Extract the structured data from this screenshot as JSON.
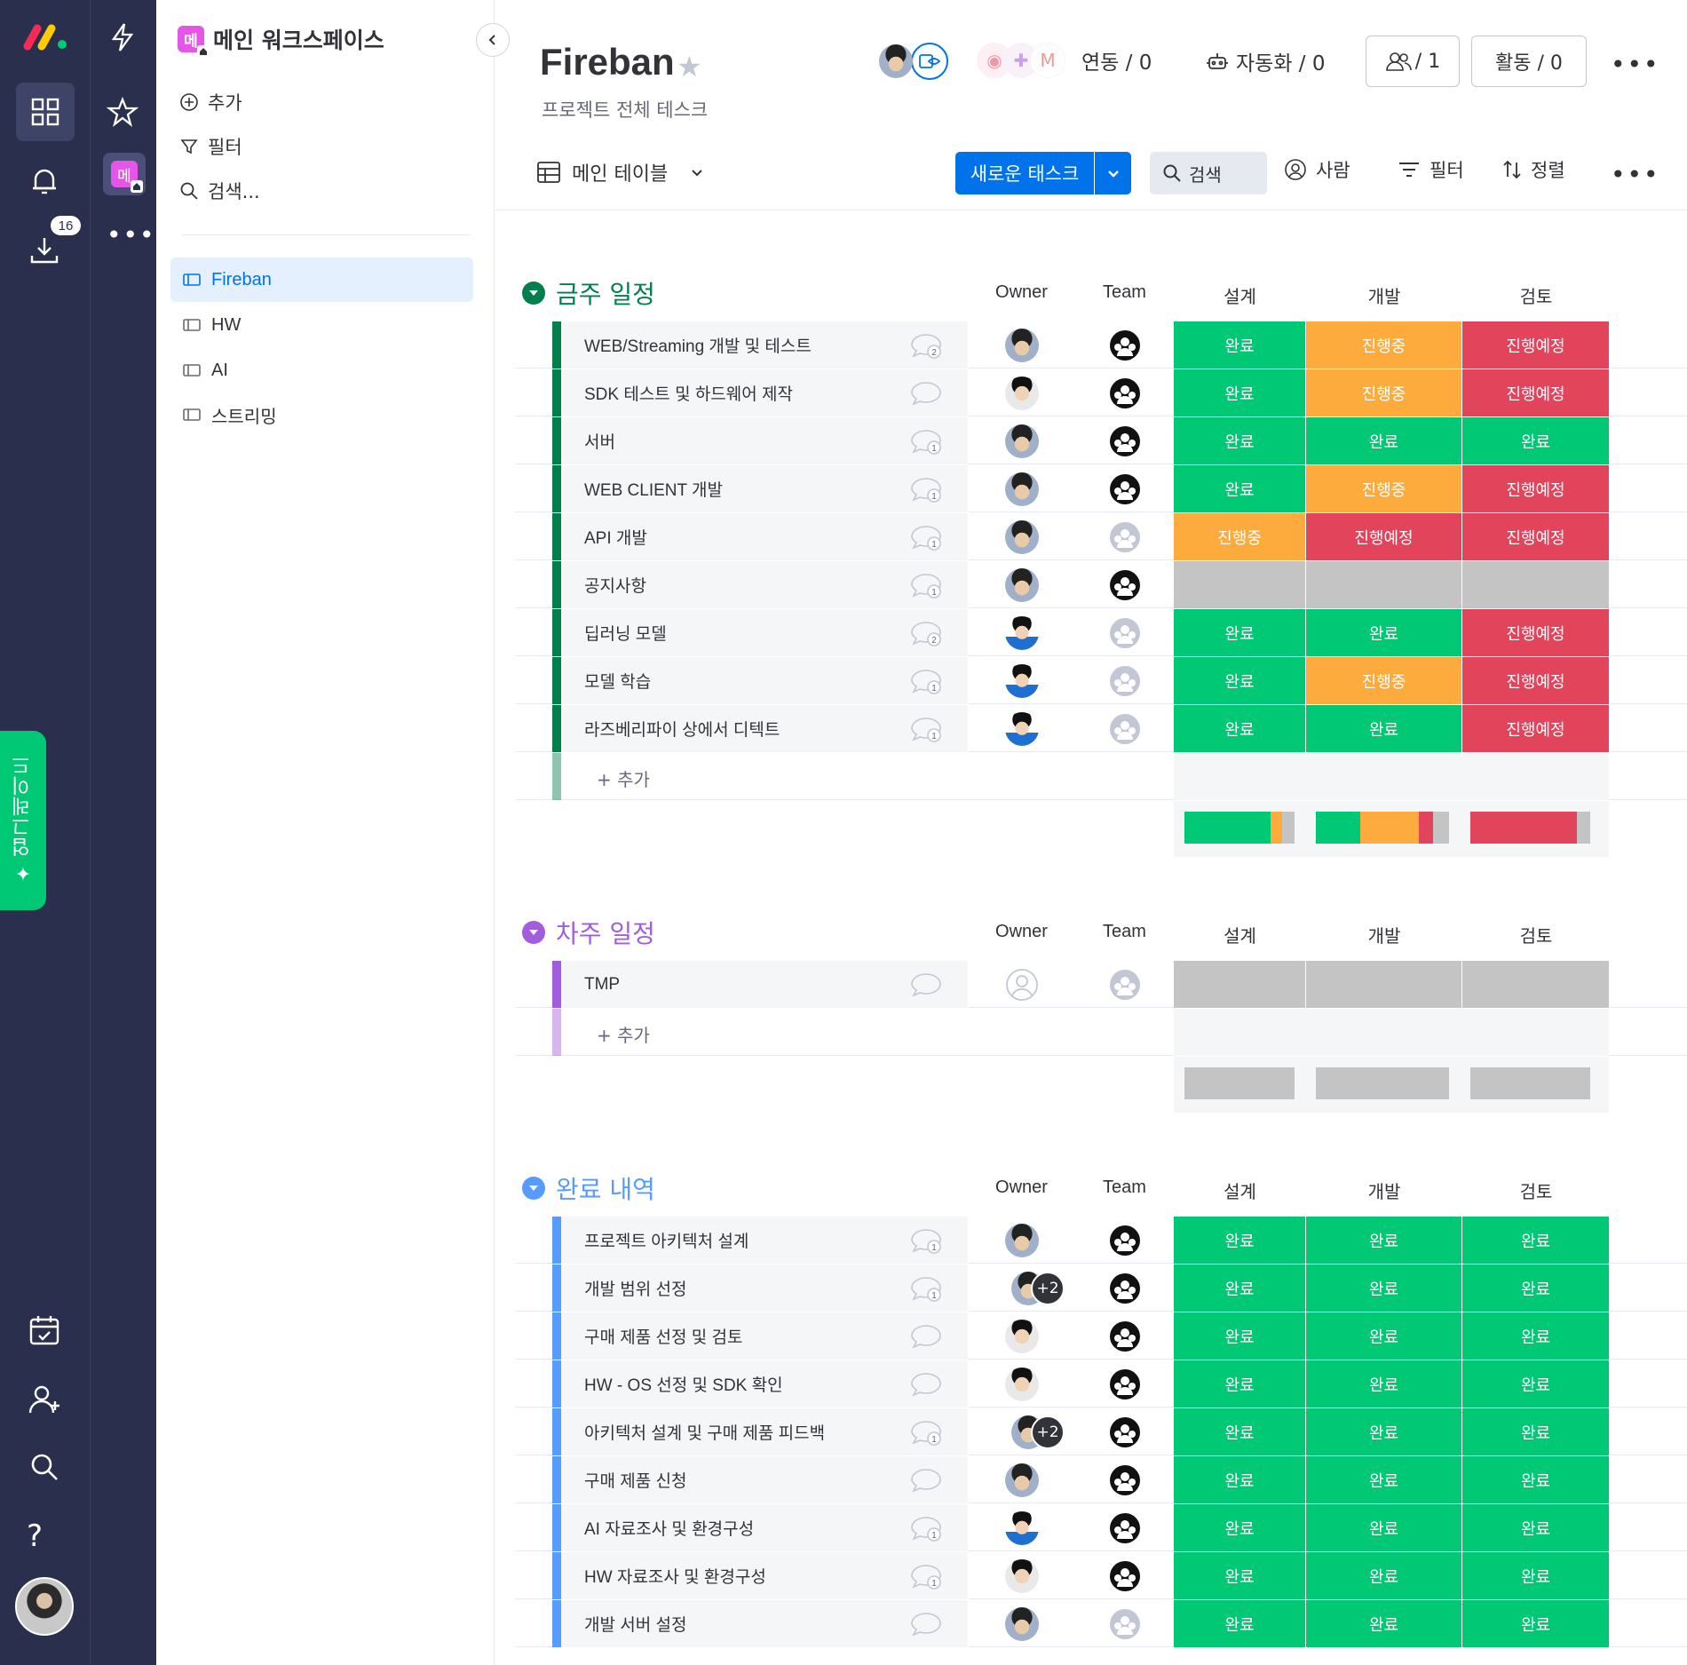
{
  "rail": {
    "download_badge": "16",
    "gradient_label": "업그레이드"
  },
  "sidebar": {
    "workspace_initial": "메",
    "workspace_name": "메인 워크스페이스",
    "menu": {
      "add": "추가",
      "filter": "필터",
      "search": "검색..."
    },
    "boards": [
      {
        "label": "Fireban"
      },
      {
        "label": "HW"
      },
      {
        "label": "AI"
      },
      {
        "label": "스트리밍"
      }
    ]
  },
  "header": {
    "title": "Fireban",
    "description": "프로젝트 전체 테스크",
    "integrations_label": "연동 / 0",
    "automations_label": "자동화 / 0",
    "members_count": "/ 1",
    "activity_label": "활동 / 0",
    "view_label": "메인 테이블",
    "new_task": "새로운 태스크",
    "search_label": "검색",
    "person_label": "사람",
    "filter_label": "필터",
    "sort_label": "정렬"
  },
  "columns": {
    "owner": "Owner",
    "team": "Team",
    "design": "설계",
    "dev": "개발",
    "review": "검토"
  },
  "colors": {
    "done": "#00c875",
    "working": "#fdab3d",
    "planned": "#e2445c",
    "empty": "#c4c4c4"
  },
  "groups": [
    {
      "title": "금주 일정",
      "color": "#037f4c",
      "add_label": "+ 추가",
      "rows": [
        {
          "name": "WEB/Streaming 개발 및 테스트",
          "chat": "2",
          "owner": "a",
          "team": "dark",
          "s": [
            "완료",
            "진행중",
            "진행예정"
          ]
        },
        {
          "name": "SDK 테스트 및 하드웨어 제작",
          "chat": "",
          "owner": "b",
          "team": "dark",
          "s": [
            "완료",
            "진행중",
            "진행예정"
          ]
        },
        {
          "name": "서버",
          "chat": "1",
          "owner": "a",
          "team": "dark",
          "s": [
            "완료",
            "완료",
            "완료"
          ]
        },
        {
          "name": "WEB CLIENT 개발",
          "chat": "1",
          "owner": "a",
          "team": "dark",
          "s": [
            "완료",
            "진행중",
            "진행예정"
          ]
        },
        {
          "name": "API 개발",
          "chat": "1",
          "owner": "a",
          "team": "light",
          "s": [
            "진행중",
            "진행예정",
            "진행예정"
          ]
        },
        {
          "name": "공지사항",
          "chat": "1",
          "owner": "a",
          "team": "dark",
          "s": [
            "",
            "",
            ""
          ]
        },
        {
          "name": "딥러닝 모델",
          "chat": "2",
          "owner": "c",
          "team": "light",
          "s": [
            "완료",
            "완료",
            "진행예정"
          ]
        },
        {
          "name": "모델 학습",
          "chat": "1",
          "owner": "c",
          "team": "light",
          "s": [
            "완료",
            "진행중",
            "진행예정"
          ]
        },
        {
          "name": "라즈베리파이 상에서 디텍트",
          "chat": "1",
          "owner": "c",
          "team": "light",
          "s": [
            "완료",
            "완료",
            "진행예정"
          ]
        }
      ],
      "summary": [
        {
          "done": 0.78,
          "working": 0.11,
          "planned": 0,
          "empty": 0.11
        },
        {
          "done": 0.33,
          "working": 0.44,
          "planned": 0.11,
          "empty": 0.12
        },
        {
          "done": 0,
          "working": 0,
          "planned": 0.89,
          "empty": 0.11
        }
      ]
    },
    {
      "title": "차주 일정",
      "color": "#a25ddc",
      "add_label": "+ 추가",
      "rows": [
        {
          "name": "TMP",
          "chat": "",
          "owner": "empty",
          "team": "light",
          "s": [
            "",
            "",
            ""
          ]
        }
      ],
      "summary": [
        {
          "done": 0,
          "working": 0,
          "planned": 0,
          "empty": 1
        },
        {
          "done": 0,
          "working": 0,
          "planned": 0,
          "empty": 1
        },
        {
          "done": 0,
          "working": 0,
          "planned": 0,
          "empty": 1
        }
      ]
    },
    {
      "title": "완료 내역",
      "color": "#579bfc",
      "add_label": "",
      "rows": [
        {
          "name": "프로젝트 아키텍처 설계",
          "chat": "1",
          "owner": "a",
          "team": "dark",
          "s": [
            "완료",
            "완료",
            "완료"
          ]
        },
        {
          "name": "개발 범위 선정",
          "chat": "1",
          "owner": "a+2",
          "team": "dark",
          "s": [
            "완료",
            "완료",
            "완료"
          ]
        },
        {
          "name": "구매 제품 선정 및 검토",
          "chat": "",
          "owner": "b",
          "team": "dark",
          "s": [
            "완료",
            "완료",
            "완료"
          ]
        },
        {
          "name": "HW - OS 선정 및 SDK 확인",
          "chat": "",
          "owner": "b",
          "team": "dark",
          "s": [
            "완료",
            "완료",
            "완료"
          ]
        },
        {
          "name": "아키텍처 설계 및 구매 제품 피드백",
          "chat": "1",
          "owner": "a+2",
          "team": "dark",
          "s": [
            "완료",
            "완료",
            "완료"
          ]
        },
        {
          "name": "구매 제품 신청",
          "chat": "",
          "owner": "a",
          "team": "dark",
          "s": [
            "완료",
            "완료",
            "완료"
          ]
        },
        {
          "name": "AI 자료조사 및 환경구성",
          "chat": "1",
          "owner": "c",
          "team": "dark",
          "s": [
            "완료",
            "완료",
            "완료"
          ]
        },
        {
          "name": "HW 자료조사 및 환경구성",
          "chat": "1",
          "owner": "b",
          "team": "dark",
          "s": [
            "완료",
            "완료",
            "완료"
          ]
        },
        {
          "name": "개발 서버 설정",
          "chat": "",
          "owner": "a",
          "team": "light",
          "s": [
            "완료",
            "완료",
            "완료"
          ]
        }
      ]
    }
  ]
}
